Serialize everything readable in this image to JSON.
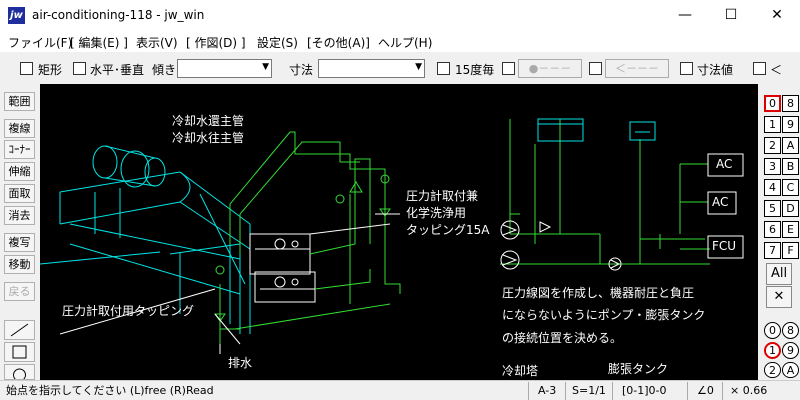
{
  "window": {
    "title": "air-conditioning-118 - jw_win",
    "icon_label": "jw",
    "controls": {
      "minimize": "—",
      "maximize": "☐",
      "close": "✕"
    }
  },
  "menu": [
    {
      "label": "ファイル(F)"
    },
    {
      "label": "[ 編集(E) ]"
    },
    {
      "label": "表示(V)"
    },
    {
      "label": "[ 作図(D) ]"
    },
    {
      "label": "設定(S)"
    },
    {
      "label": "[その他(A)]"
    },
    {
      "label": "ヘルプ(H)"
    }
  ],
  "toolbar": {
    "rect_label": "矩形",
    "hv_label": "水平･垂直",
    "angle_label": "傾き",
    "angle_value": "",
    "dimension_label": "寸法",
    "dimension_value": "",
    "step15_label": "15度毎",
    "btn_dot": "●－－－",
    "btn_arrow": "＜－－－",
    "dimval_label": "寸法値",
    "less_label": "＜"
  },
  "left_tools": [
    {
      "label": "範囲",
      "enabled": true
    },
    {
      "label": "複線",
      "enabled": true
    },
    {
      "label": "ｺｰﾅｰ",
      "enabled": true
    },
    {
      "label": "伸縮",
      "enabled": true
    },
    {
      "label": "面取",
      "enabled": true
    },
    {
      "label": "消去",
      "enabled": true
    },
    {
      "label": "複写",
      "enabled": true
    },
    {
      "label": "移動",
      "enabled": true
    },
    {
      "label": "戻る",
      "enabled": false
    }
  ],
  "layer_groups_top": [
    [
      "0",
      "8"
    ],
    [
      "1",
      "9"
    ],
    [
      "2",
      "A"
    ],
    [
      "3",
      "B"
    ],
    [
      "4",
      "C"
    ],
    [
      "5",
      "D"
    ],
    [
      "6",
      "E"
    ],
    [
      "7",
      "F"
    ]
  ],
  "layer_all": "All",
  "layer_close": "✕",
  "layers_bottom": [
    [
      "0",
      "8"
    ],
    [
      "1",
      "9"
    ],
    [
      "2",
      "A"
    ]
  ],
  "drawing": {
    "notes": {
      "return_pipe": "冷却水還主管",
      "supply_pipe": "冷却水往主管",
      "gauge_line1": "圧力計取付兼",
      "gauge_line2": "化学洗浄用",
      "gauge_line3": "タッピング15A",
      "gauge_tap": "圧力計取付用タッピング",
      "drain": "排水",
      "desc_line1": "圧力線図を作成し、機器耐圧と負圧",
      "desc_line2": "にならないようにポンプ・膨張タンク",
      "desc_line3": "の接続位置を決める。",
      "cooling_tower": "冷却塔",
      "expansion_tank": "膨張タンク"
    },
    "units": {
      "ac1": "AC",
      "ac2": "AC",
      "fcu": "FCU"
    }
  },
  "status": {
    "message": "始点を指示してください (L)free (R)Read",
    "paper": "A-3",
    "scale": "S=1/1",
    "layer": "[0-1]0-0",
    "angle": "∠0",
    "zoom": "× 0.66"
  },
  "colors": {
    "cyan": "#00e5e5",
    "green": "#33dd33",
    "white": "#ffffff",
    "canvas": "#000000",
    "active_layer": "#dd0000"
  }
}
